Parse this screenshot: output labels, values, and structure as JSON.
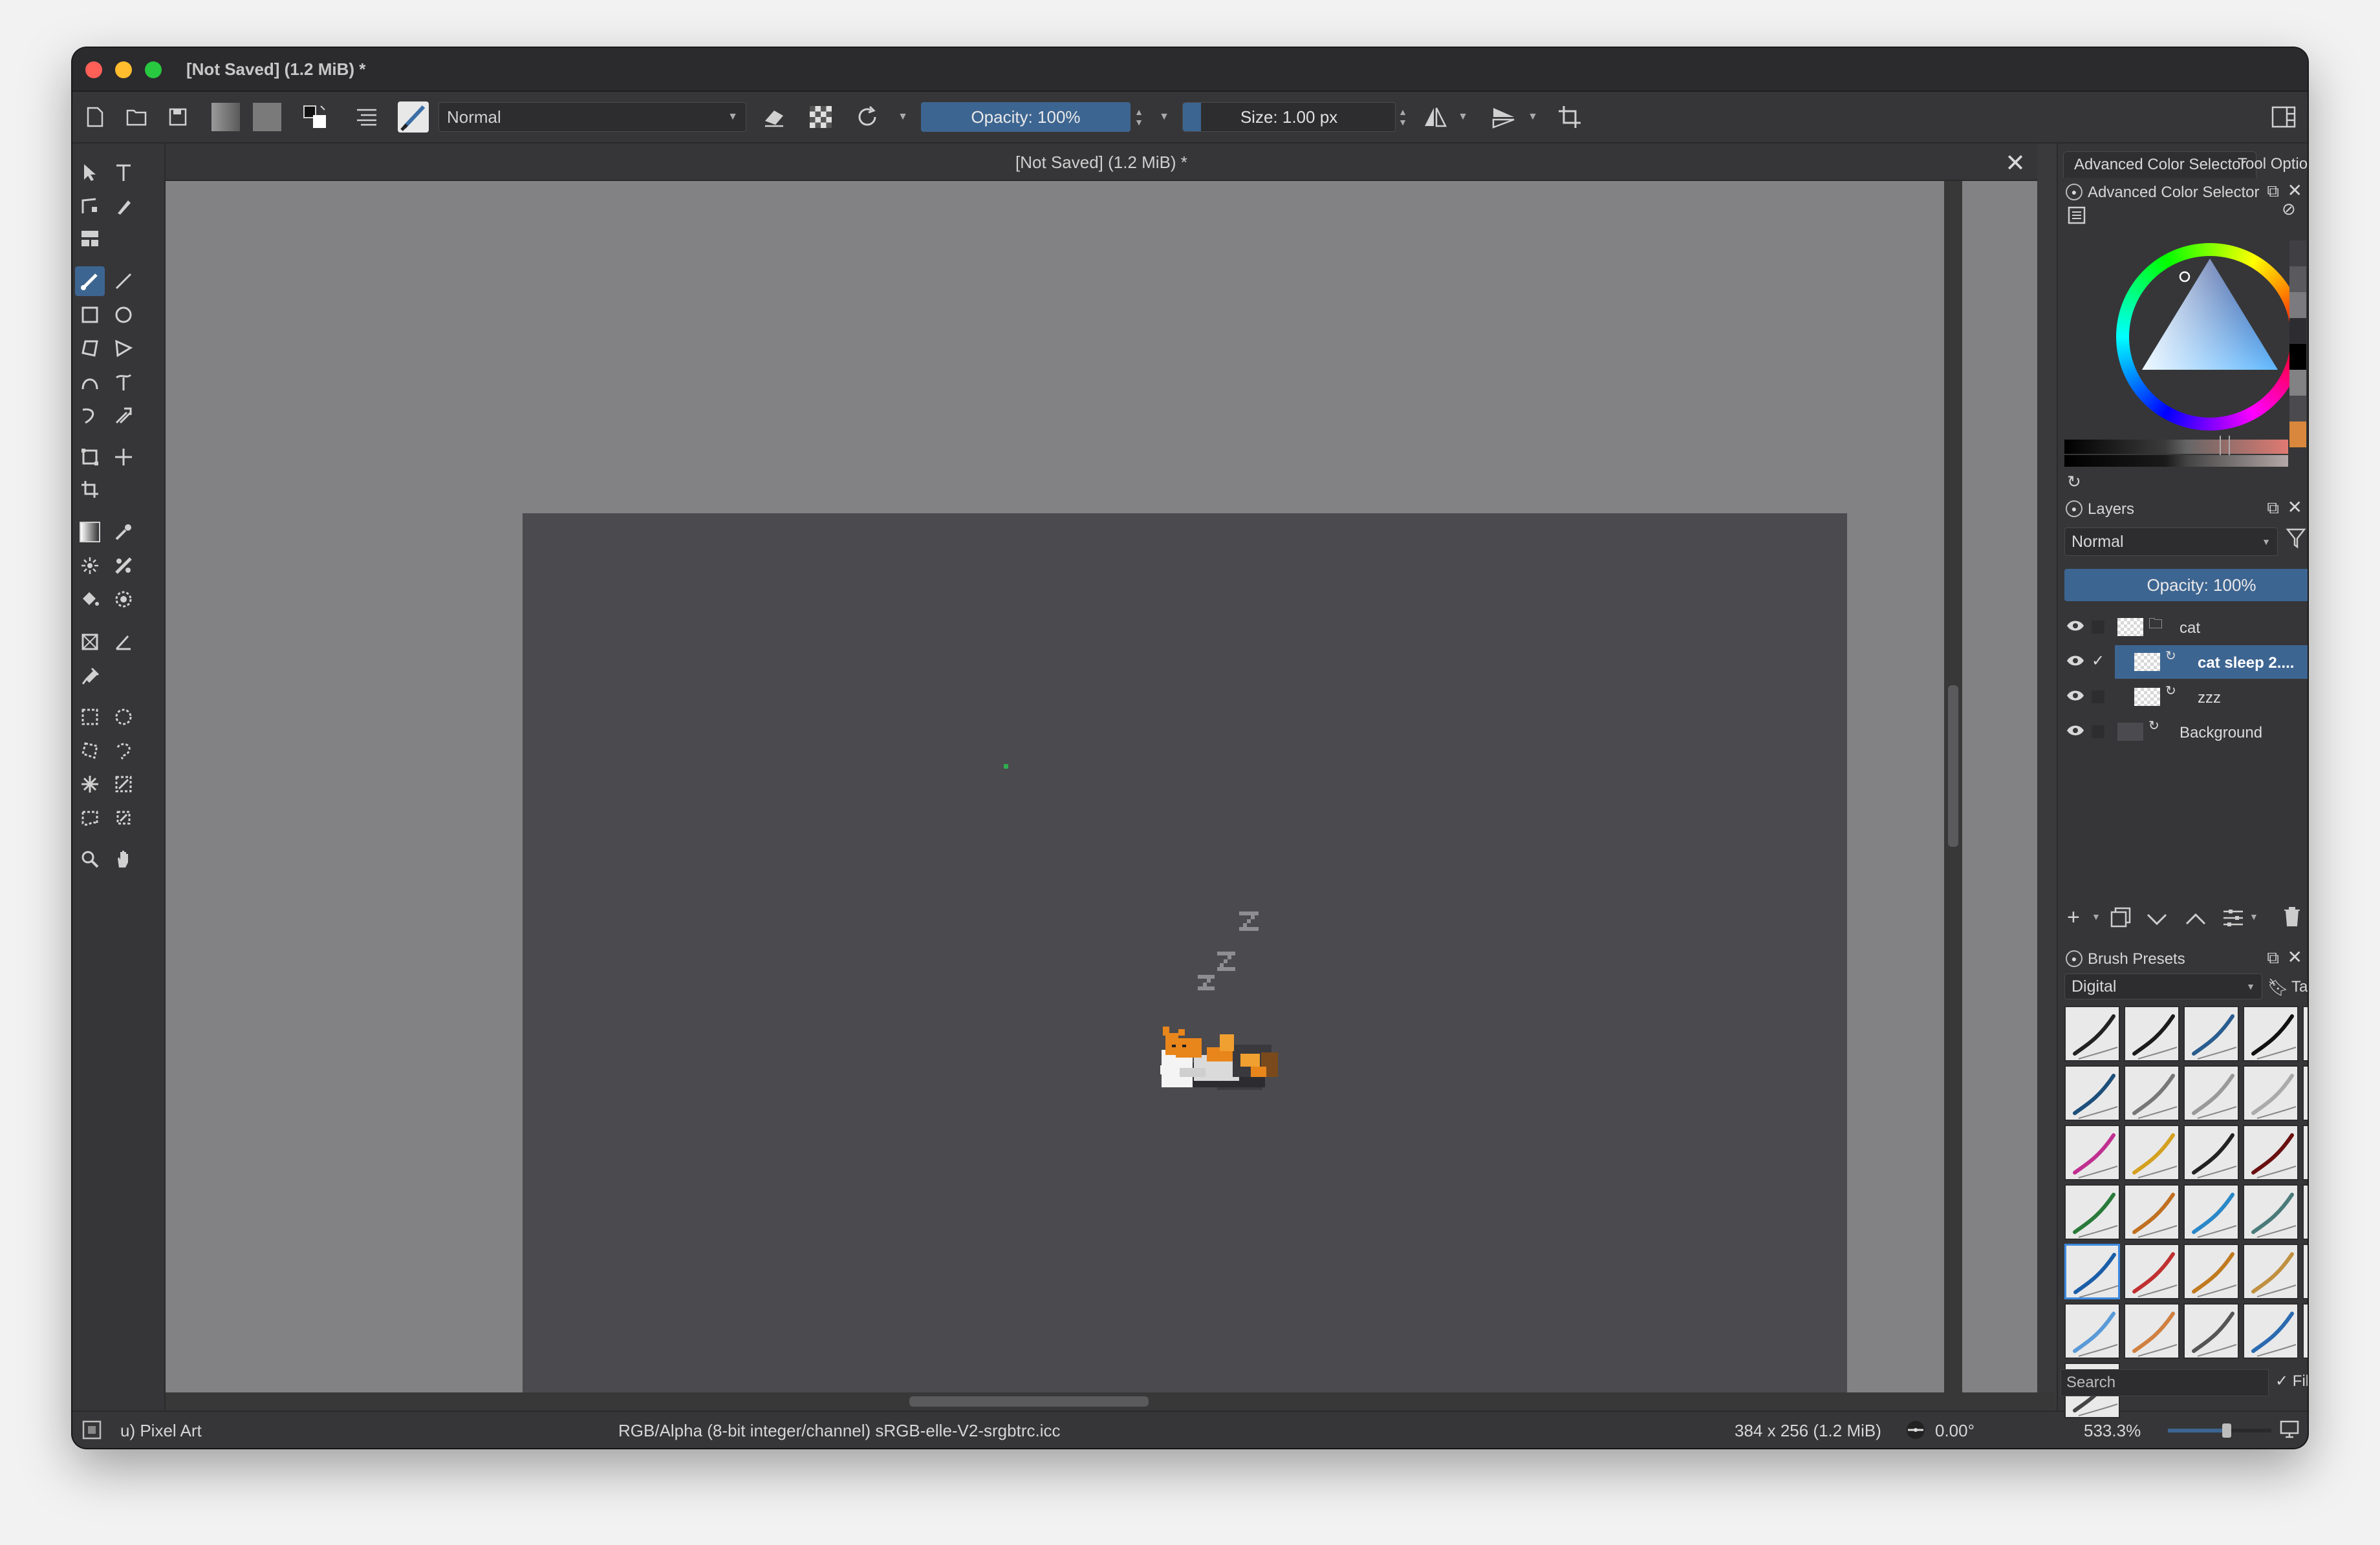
{
  "window": {
    "title": "[Not Saved]  (1.2 MiB) *"
  },
  "toolbar": {
    "blend_mode": "Normal",
    "opacity_label": "Opacity: 100%",
    "size_label": "Size: 1.00 px",
    "icons": [
      "new-document-icon",
      "open-document-icon",
      "save-icon",
      "gradient-icon",
      "pattern-icon",
      "swap-colors-icon",
      "brush-settings-icon",
      "brush-preset-icon",
      "eraser-icon",
      "alpha-lock-icon",
      "reload-icon",
      "mirror-horizontal-icon",
      "mirror-vertical-icon",
      "wrap-around-icon",
      "workspace-icon"
    ]
  },
  "document": {
    "tab_title": "[Not Saved]  (1.2 MiB) *",
    "close_glyph": "✕"
  },
  "canvas": {
    "background_color": "#828284",
    "image_color": "#4b4a4e"
  },
  "statusbar": {
    "brush": "u) Pixel Art",
    "color_space": "RGB/Alpha (8-bit integer/channel)  sRGB-elle-V2-srgbtrc.icc",
    "image_size": "384 x 256 (1.2 MiB)",
    "rotation": "0.00°",
    "zoom": "533.3%"
  },
  "dock": {
    "tabs": [
      "Advanced Color Selector",
      "Tool Options"
    ],
    "color_selector_title": "Advanced Color Selector",
    "layers": {
      "title": "Layers",
      "blend_mode": "Normal",
      "opacity_label": "Opacity: 100%",
      "items": [
        {
          "name": "cat",
          "selected": false,
          "locked": false,
          "checked": false
        },
        {
          "name": "cat sleep 2....",
          "selected": true,
          "locked": false,
          "checked": true
        },
        {
          "name": "zzz",
          "selected": false,
          "locked": false,
          "checked": false
        },
        {
          "name": "Background",
          "selected": false,
          "locked": true,
          "checked": false
        }
      ]
    },
    "brush_presets": {
      "title": "Brush Presets",
      "tag_select": "Digital",
      "tag_button": "Tag",
      "search_placeholder": "Search",
      "filter_label": "Filter in Tag",
      "filter_checked": true,
      "selected_index": 20,
      "count": 31
    }
  },
  "colors": {
    "accent": "#3d6591",
    "window_bg": "#3a3a3c"
  }
}
